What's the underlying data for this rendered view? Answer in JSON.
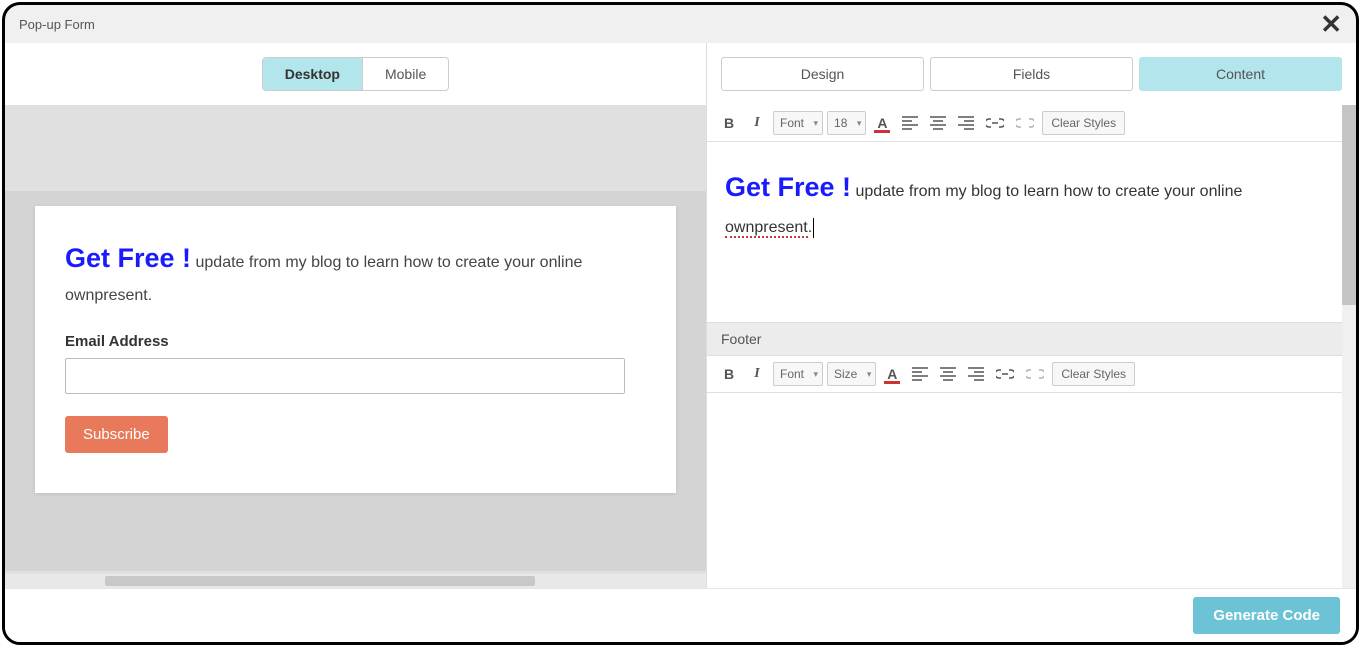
{
  "window": {
    "title": "Pop-up Form"
  },
  "device_tabs": {
    "desktop": "Desktop",
    "mobile": "Mobile",
    "active": "desktop"
  },
  "preview": {
    "headline_big": "Get Free !",
    "headline_rest": " update from my blog to learn how to create your online ownpresent.",
    "email_label": "Email Address",
    "subscribe": "Subscribe"
  },
  "right_tabs": {
    "design": "Design",
    "fields": "Fields",
    "content": "Content",
    "active": "content"
  },
  "toolbar": {
    "font_label": "Font",
    "size_value": "18",
    "size_label": "Size",
    "clear": "Clear Styles"
  },
  "editor": {
    "big": "Get Free !",
    "rest1": " update from my blog to learn how to create your online ",
    "rest2": "ownpresent",
    "rest3": "."
  },
  "sections": {
    "footer": "Footer"
  },
  "actions": {
    "generate": "Generate Code"
  }
}
